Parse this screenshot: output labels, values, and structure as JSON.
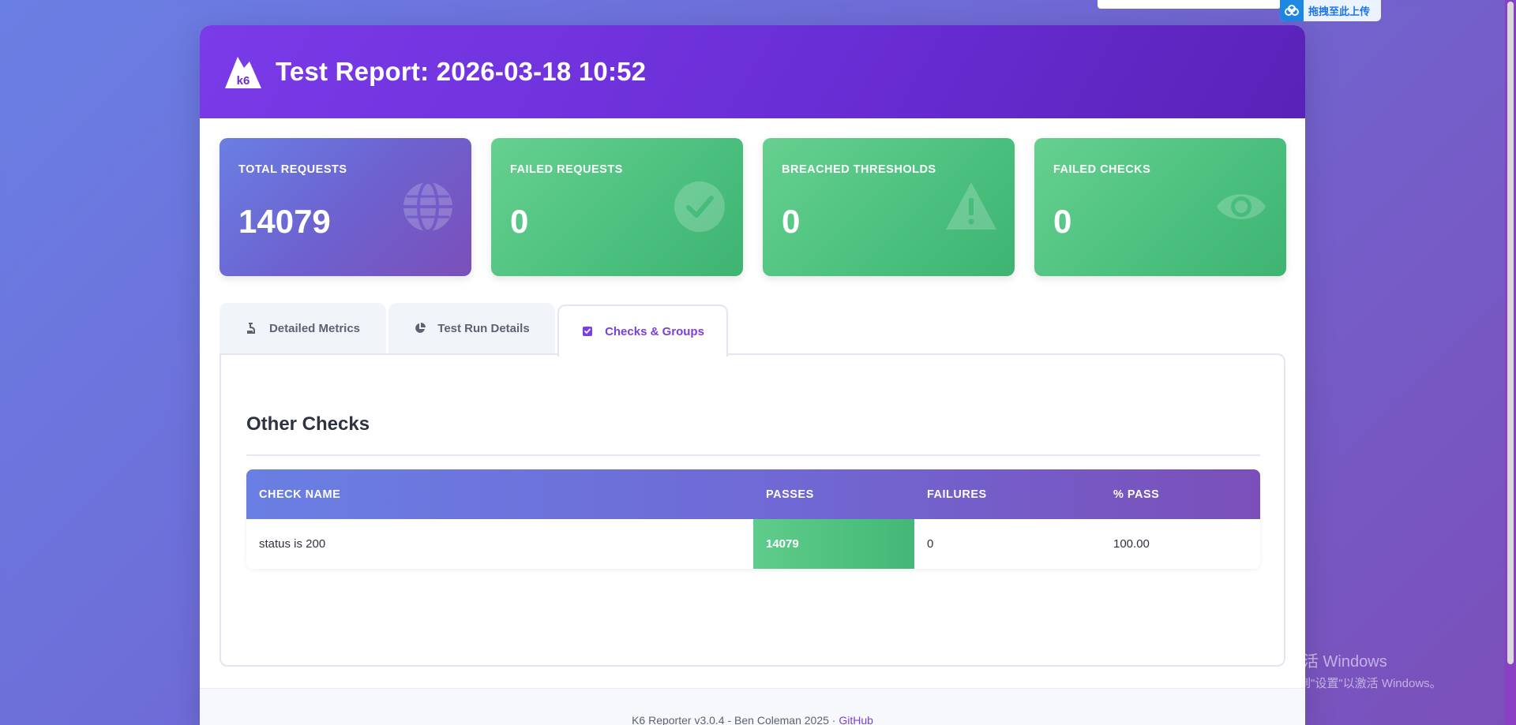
{
  "upload_widget": {
    "label": "拖拽至此上传",
    "icon": "cloud-upload-icon"
  },
  "header": {
    "title": "Test Report: 2026-03-18 10:52",
    "logo_text": "k6"
  },
  "stats": [
    {
      "label": "TOTAL REQUESTS",
      "value": "14079",
      "icon": "globe-icon",
      "color": "#6f6ad6"
    },
    {
      "label": "FAILED REQUESTS",
      "value": "0",
      "icon": "check-circle-icon",
      "color": "#4bc07e"
    },
    {
      "label": "BREACHED THRESHOLDS",
      "value": "0",
      "icon": "warning-icon",
      "color": "#4bc07e"
    },
    {
      "label": "FAILED CHECKS",
      "value": "0",
      "icon": "eye-icon",
      "color": "#4bc07e"
    }
  ],
  "tabs": [
    {
      "label": "Detailed Metrics",
      "icon": "flask-icon",
      "active": false
    },
    {
      "label": "Test Run Details",
      "icon": "pie-chart-icon",
      "active": false
    },
    {
      "label": "Checks & Groups",
      "icon": "checkbox-icon",
      "active": true
    }
  ],
  "checks": {
    "section_title": "Other Checks",
    "columns": [
      "CHECK NAME",
      "PASSES",
      "FAILURES",
      "% PASS"
    ],
    "rows": [
      {
        "name": "status is 200",
        "passes": "14079",
        "failures": "0",
        "pass_pct": "100.00"
      }
    ]
  },
  "footer": {
    "text": "K6 Reporter v3.0.4 - Ben Coleman 2025 · ",
    "link": "GitHub"
  },
  "watermark": {
    "line1": "激活 Windows",
    "line2": "转到\"设置\"以激活 Windows。"
  },
  "colors": {
    "accent": "#7b3fe0",
    "success": "#4bc07e",
    "header": "#6a2ed6"
  }
}
